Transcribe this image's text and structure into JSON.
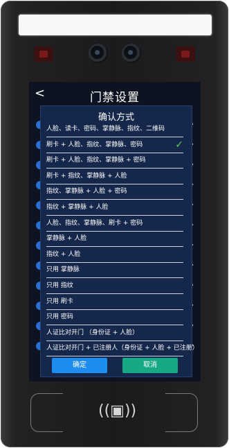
{
  "screen": {
    "back_icon": "chevron-left-icon",
    "title": "门禁设置"
  },
  "dialog": {
    "title": "确认方式",
    "options": [
      {
        "label": "人脸、读卡、密码、掌静脉、指纹、二维码",
        "selected": false
      },
      {
        "label": "刷卡 + 人脸、指纹、掌静脉、密码",
        "selected": true
      },
      {
        "label": "刷卡 + 人脸、指纹、掌静脉 + 密码",
        "selected": false
      },
      {
        "label": "刷卡 + 指纹、掌静脉 + 人脸",
        "selected": false
      },
      {
        "label": "指纹、掌静脉 + 人脸 + 密码",
        "selected": false
      },
      {
        "label": "指纹 + 掌静脉 + 人脸",
        "selected": false
      },
      {
        "label": "人脸、指纹、掌静脉、刷卡 + 密码",
        "selected": false
      },
      {
        "label": "掌静脉 + 人脸",
        "selected": false
      },
      {
        "label": "指纹 + 人脸",
        "selected": false
      },
      {
        "label": "只用 掌静脉",
        "selected": false
      },
      {
        "label": "只用 指纹",
        "selected": false
      },
      {
        "label": "只用 刷卡",
        "selected": false
      },
      {
        "label": "只用 密码",
        "selected": false
      },
      {
        "label": "人证比对开门 （身份证 + 人脸）",
        "selected": false
      },
      {
        "label": "人证比对开门 + 已注册人（身份证 + 人脸 + 已注册）",
        "selected": false
      }
    ],
    "confirm_label": "确定",
    "cancel_label": "取消"
  },
  "colors": {
    "dialog_bg": "#15274a",
    "confirm": "#1f8cf0",
    "cancel": "#17a886",
    "check": "#5fcf6a"
  },
  "device": {
    "nfc_icon": "nfc-card-reader-icon"
  }
}
